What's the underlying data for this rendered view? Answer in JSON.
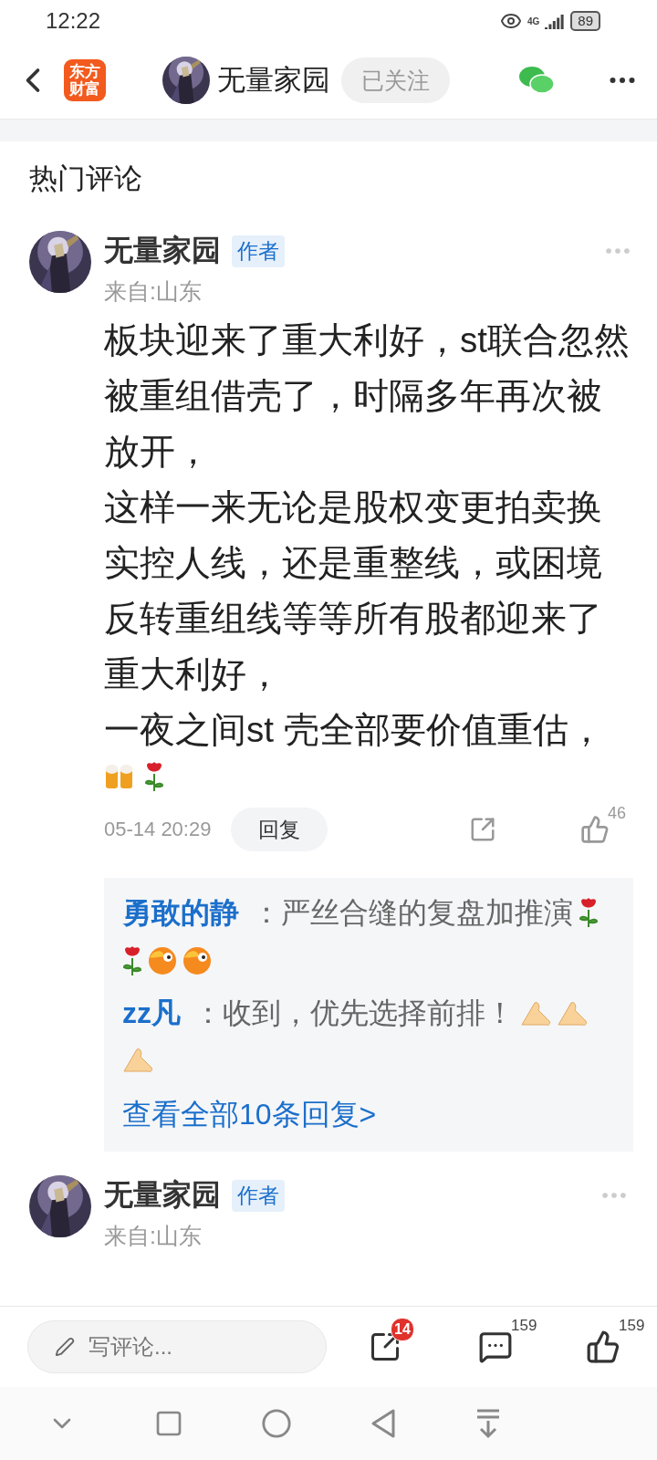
{
  "status_bar": {
    "time": "12:22",
    "network": "4G",
    "battery": "89"
  },
  "header": {
    "logo_lines": [
      "东方",
      "财富"
    ],
    "author": "无量家园",
    "follow": {
      "label": "已关注",
      "selected": true
    }
  },
  "section_title": "热门评论",
  "comments": [
    {
      "author": "无量家园",
      "badge": "作者",
      "location": "来自:山东",
      "body_lines": [
        "板块迎来了重大利好，st联合忽然",
        "被重组借壳了，时隔多年再次被",
        "放开，",
        "这样一来无论是股权变更拍卖换",
        "实控人线，还是重整线，或困境",
        "反转重组线等等所有股都迎来了",
        "重大利好，",
        "一夜之间st 壳全部要价值重估，"
      ],
      "emojis": [
        {
          "kind": "beer"
        },
        {
          "kind": "rose"
        }
      ],
      "time": "05-14 20:29",
      "reply_label": "回复",
      "likes": "46",
      "replies": [
        {
          "author": "勇敢的静",
          "text": "：严丝合缝的复盘加推演",
          "emojis": [
            {
              "kind": "rose"
            },
            {
              "kind": "rose"
            },
            {
              "kind": "face"
            },
            {
              "kind": "face"
            }
          ]
        },
        {
          "author": "zz凡",
          "text": "：收到，优先选择前排！",
          "emojis": [
            {
              "kind": "clap"
            },
            {
              "kind": "clap"
            },
            {
              "kind": "clap"
            }
          ]
        }
      ],
      "more_link": "查看全部10条回复>"
    },
    {
      "author": "无量家园",
      "badge": "作者",
      "location": "来自:山东"
    }
  ],
  "bottom_bar": {
    "placeholder": "写评论...",
    "share_badge": "14",
    "comments": "159",
    "likes": "159"
  }
}
